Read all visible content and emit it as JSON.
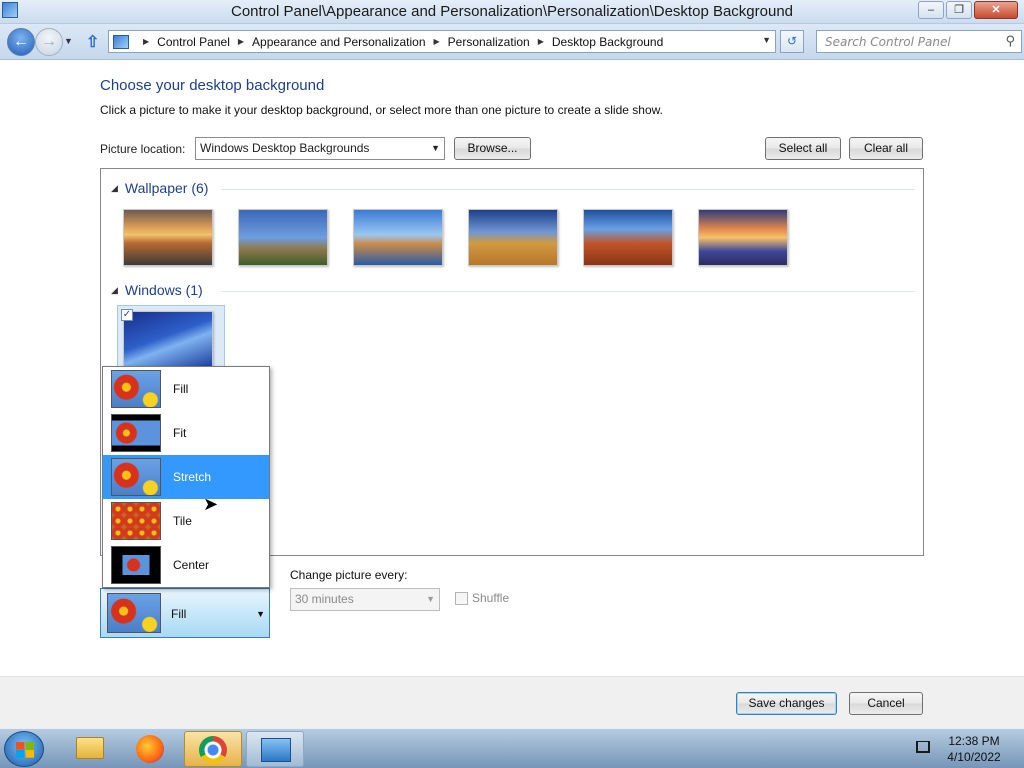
{
  "window": {
    "title": "Control Panel\\Appearance and Personalization\\Personalization\\Desktop Background",
    "minimize": "–",
    "maximize": "❐",
    "close": "✕"
  },
  "nav": {
    "back": "←",
    "forward": "→",
    "recent": "▼",
    "up": "⇧",
    "breadcrumbs": [
      "Control Panel",
      "Appearance and Personalization",
      "Personalization",
      "Desktop Background"
    ],
    "breadcrumb_sep": "▶",
    "address_drop": "▼",
    "refresh": "↺",
    "search_placeholder": "Search Control Panel",
    "search_icon": "⚲"
  },
  "content": {
    "heading": "Choose your desktop background",
    "subheading": "Click a picture to make it your desktop background, or select more than one picture to create a slide show.",
    "picture_location_label": "Picture location:",
    "picture_location_value": "Windows Desktop Backgrounds",
    "browse_label": "Browse...",
    "select_all_label": "Select all",
    "clear_all_label": "Clear all"
  },
  "groups": [
    {
      "title": "Wallpaper (6)",
      "expanded_icon": "◢"
    },
    {
      "title": "Windows (1)",
      "expanded_icon": "◢"
    }
  ],
  "selected_check": "✓",
  "position": {
    "options": [
      "Fill",
      "Fit",
      "Stretch",
      "Tile",
      "Center"
    ],
    "highlighted": "Stretch",
    "current": "Fill",
    "arrow": "▼"
  },
  "slideshow": {
    "change_label": "Change picture every:",
    "interval_value": "30 minutes",
    "shuffle_label": "Shuffle"
  },
  "footer": {
    "save_label": "Save changes",
    "cancel_label": "Cancel"
  },
  "taskbar": {
    "time": "12:38 PM",
    "date": "4/10/2022"
  },
  "cursor": "➤",
  "colors": {
    "heading_blue": "#1e3f8a",
    "highlight": "#3399ff"
  }
}
